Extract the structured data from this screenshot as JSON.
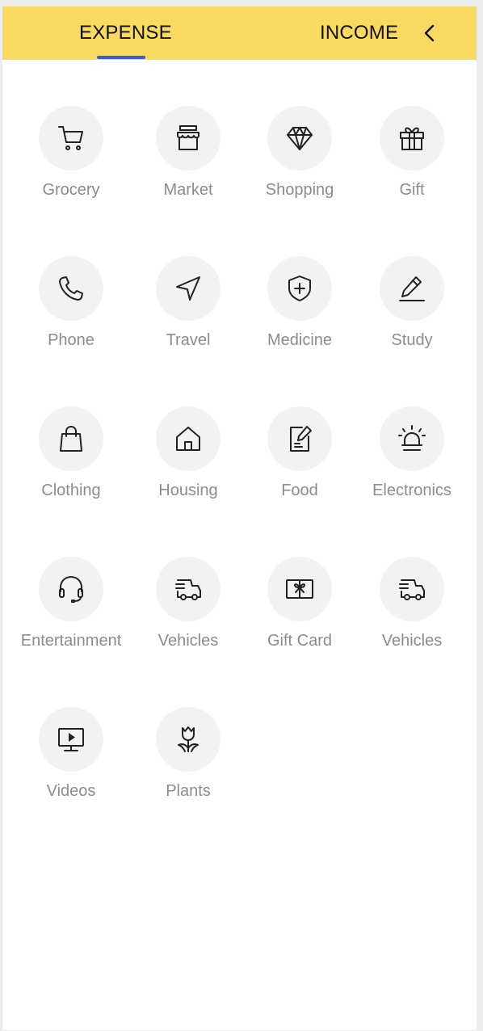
{
  "tabs": {
    "expense": "EXPENSE",
    "income": "INCOME",
    "active": "expense"
  },
  "colors": {
    "header_bg": "#fad961",
    "tab_indicator": "#3b5bdb",
    "icon_circle": "#f2f2f2",
    "label_text": "#8c8c8c"
  },
  "back_icon": "chevron-left-icon",
  "categories": [
    {
      "label": "Grocery",
      "icon": "cart-icon"
    },
    {
      "label": "Market",
      "icon": "storefront-icon"
    },
    {
      "label": "Shopping",
      "icon": "diamond-icon"
    },
    {
      "label": "Gift",
      "icon": "gift-icon"
    },
    {
      "label": "Phone",
      "icon": "phone-icon"
    },
    {
      "label": "Travel",
      "icon": "navigation-icon"
    },
    {
      "label": "Medicine",
      "icon": "shield-plus-icon"
    },
    {
      "label": "Study",
      "icon": "pencil-icon"
    },
    {
      "label": "Clothing",
      "icon": "shopping-bag-icon"
    },
    {
      "label": "Housing",
      "icon": "house-icon"
    },
    {
      "label": "Food",
      "icon": "note-edit-icon"
    },
    {
      "label": "Electronics",
      "icon": "alarm-light-icon"
    },
    {
      "label": "Entertainment",
      "icon": "headset-icon"
    },
    {
      "label": "Vehicles",
      "icon": "truck-icon"
    },
    {
      "label": "Gift Card",
      "icon": "gift-card-icon"
    },
    {
      "label": "Vehicles",
      "icon": "truck-icon"
    },
    {
      "label": "Videos",
      "icon": "monitor-play-icon"
    },
    {
      "label": "Plants",
      "icon": "tulip-icon"
    }
  ]
}
